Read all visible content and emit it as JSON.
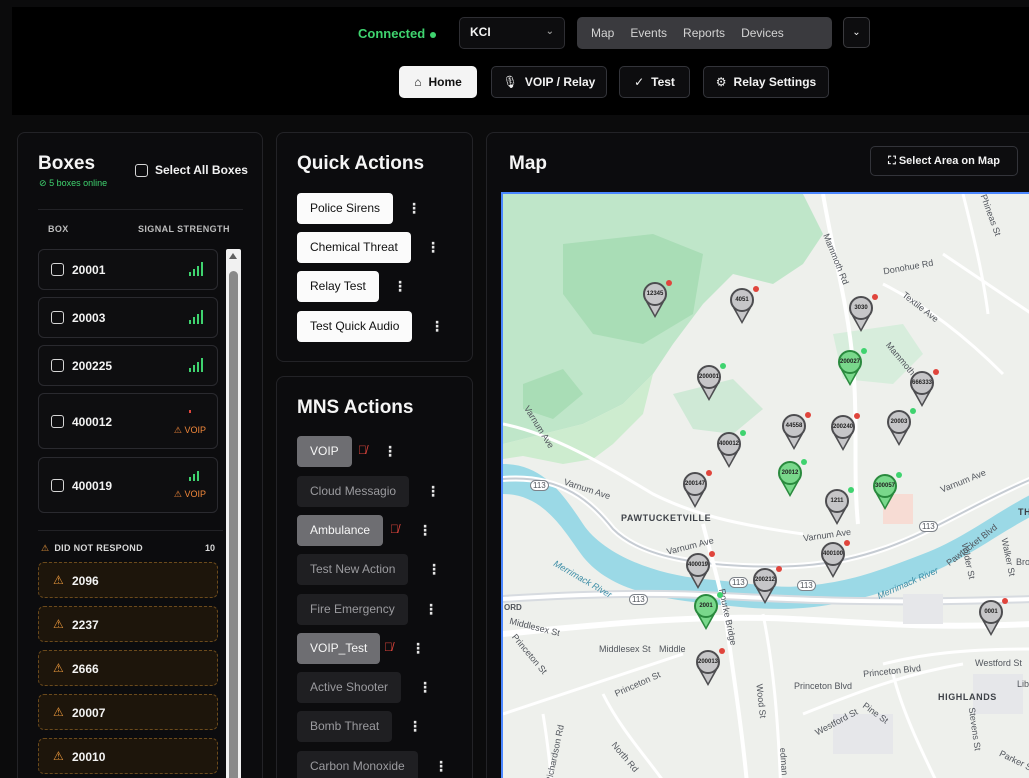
{
  "header": {
    "connection_status": "Connected",
    "location_select": {
      "value": "KCI"
    },
    "nav_tabs": [
      "Map",
      "Events",
      "Reports",
      "Devices"
    ],
    "sub_nav": [
      {
        "label": "Home",
        "icon": "home-icon",
        "active": true
      },
      {
        "label": "VOIP / Relay",
        "icon": "microphone-icon",
        "active": false
      },
      {
        "label": "Test",
        "icon": "checkmark-icon",
        "active": false
      },
      {
        "label": "Relay Settings",
        "icon": "gear-icon",
        "active": false
      }
    ]
  },
  "boxes": {
    "title": "Boxes",
    "online_text": "5 boxes online",
    "select_all_label": "Select All Boxes",
    "columns": [
      "BOX",
      "SIGNAL STRENGTH"
    ],
    "items": [
      {
        "id": "20001",
        "signal": "strong",
        "voip_warning": ""
      },
      {
        "id": "20003",
        "signal": "strong",
        "voip_warning": ""
      },
      {
        "id": "200225",
        "signal": "strong",
        "voip_warning": ""
      },
      {
        "id": "400012",
        "signal": "weak",
        "voip_warning": "VOIP"
      },
      {
        "id": "400019",
        "signal": "medium",
        "voip_warning": "VOIP"
      }
    ],
    "did_not_respond": {
      "label": "DID NOT RESPOND",
      "count": "10",
      "items": [
        "2096",
        "2237",
        "2666",
        "20007",
        "20010"
      ]
    }
  },
  "quick_actions": {
    "title": "Quick Actions",
    "items": [
      "Police Sirens",
      "Chemical Threat",
      "Relay Test",
      "Test Quick Audio"
    ]
  },
  "mns_actions": {
    "title": "MNS Actions",
    "items": [
      {
        "label": "VOIP",
        "enabled": true,
        "muted": true
      },
      {
        "label": "Cloud Messagio",
        "enabled": false,
        "muted": false
      },
      {
        "label": "Ambulance",
        "enabled": true,
        "muted": true
      },
      {
        "label": "Test New Action",
        "enabled": false,
        "muted": false
      },
      {
        "label": "Fire Emergency",
        "enabled": false,
        "muted": false
      },
      {
        "label": "VOIP_Test",
        "enabled": true,
        "muted": true
      },
      {
        "label": "Active Shooter",
        "enabled": false,
        "muted": false
      },
      {
        "label": "Bomb Threat",
        "enabled": false,
        "muted": false
      },
      {
        "label": "Carbon Monoxide",
        "enabled": false,
        "muted": false
      }
    ]
  },
  "map": {
    "title": "Map",
    "select_area_label": "Select Area on Map",
    "labels": {
      "phineas": "Phineas St",
      "mammoth": "Mammoth Rd",
      "donohue": "Donohue Rd",
      "textile": "Textile Ave",
      "mammoth2": "Mammoth Rd",
      "varnum": "Varnum Ave",
      "varnum2": "Varnum Ave",
      "varnum3": "Varnum Ave",
      "varnum4": "Varnum Ave",
      "varnum5": "Varnum Ave",
      "pawtucketville": "PAWTUCKETVILLE",
      "pawtucket": "Pawtucket Blvd",
      "wilder": "Wilder St",
      "walker": "Walker St",
      "merrimack": "Merrimack River",
      "merrimack2": "Merrimack River",
      "ford": "ORD",
      "middlesex": "Middlesex St",
      "middlesex2": "Middlesex St",
      "middle3": "Middle",
      "princeton": "Princeton St",
      "princeton2": "Princeton St",
      "princeton_blvd": "Princeton Blvd",
      "princeton_blvd2": "Princeton Blvd",
      "rourke": "Rourke Bridge",
      "westford": "Westford St",
      "westford2": "Westford St",
      "highlands": "HIGHLANDS",
      "wood": "Wood St",
      "pine": "Pine St",
      "stevens": "Stevens St",
      "parker": "Parker St",
      "richardson": "Richardson Rd",
      "north": "North Rd",
      "bro": "Bro",
      "lib": "Libe",
      "th": "TH",
      "r113a": "113",
      "r113b": "113",
      "r113c": "113",
      "r113d": "113",
      "r113e": "113",
      "bedman": "edman St"
    },
    "pins": [
      {
        "id": "12345",
        "status": "offline"
      },
      {
        "id": "4051",
        "status": "offline"
      },
      {
        "id": "3030",
        "status": "offline"
      },
      {
        "id": "200027",
        "status": "online"
      },
      {
        "id": "200001",
        "status": "online"
      },
      {
        "id": "666333",
        "status": "offline"
      },
      {
        "id": "44558",
        "status": "offline"
      },
      {
        "id": "200240",
        "status": "offline"
      },
      {
        "id": "20003",
        "status": "online"
      },
      {
        "id": "400012",
        "status": "online"
      },
      {
        "id": "20012",
        "status": "online"
      },
      {
        "id": "300057",
        "status": "online"
      },
      {
        "id": "200147",
        "status": "offline"
      },
      {
        "id": "1211",
        "status": "online"
      },
      {
        "id": "400100",
        "status": "offline"
      },
      {
        "id": "400019",
        "status": "offline"
      },
      {
        "id": "200212",
        "status": "offline"
      },
      {
        "id": "2001",
        "status": "online"
      },
      {
        "id": "0001",
        "status": "offline"
      },
      {
        "id": "200013",
        "status": "offline"
      }
    ]
  },
  "colors": {
    "accent_green": "#3fd36f",
    "warning_orange": "#e8963b",
    "status_red": "#e0453c",
    "pin_green": "#79d88b"
  }
}
